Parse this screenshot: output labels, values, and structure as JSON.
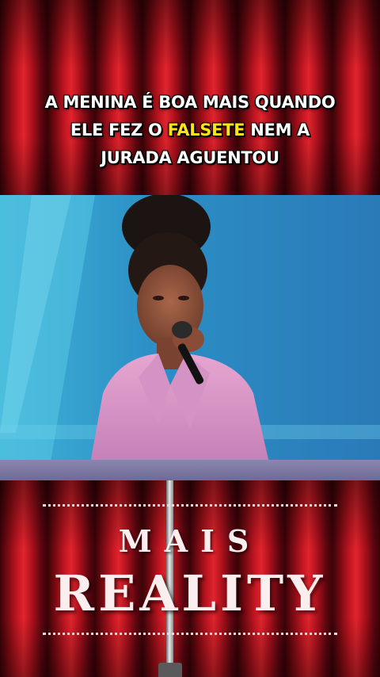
{
  "caption": {
    "line1": "A MENINA É BOA MAIS QUANDO",
    "line2_before": "ELE FEZ O ",
    "line2_highlight": "FALSETE",
    "line2_after": " NEM A",
    "line3": "JURADA AGUENTOU"
  },
  "logo": {
    "word1": "MAIS",
    "word2": "REALITY"
  },
  "colors": {
    "curtain_red": "#c41722",
    "highlight_yellow": "#ffe31a",
    "video_blue": "#2f8fc4",
    "logo_text": "#fbeeee"
  },
  "icons": {
    "microphone": "microphone-icon"
  }
}
